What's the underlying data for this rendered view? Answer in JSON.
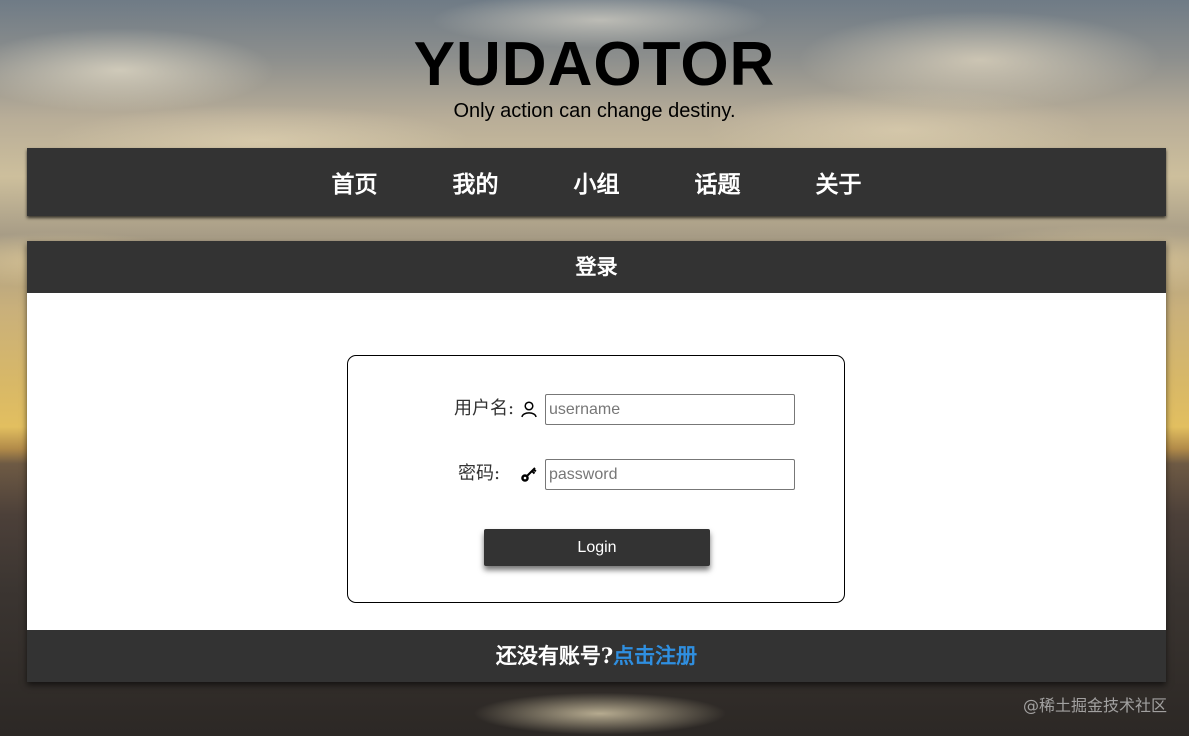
{
  "site": {
    "title": "YUDAOTOR",
    "tagline": "Only action can change destiny."
  },
  "nav": {
    "items": [
      "首页",
      "我的",
      "小组",
      "话题",
      "关于"
    ]
  },
  "login": {
    "header": "登录",
    "username_label": "用户名:",
    "username_placeholder": "username",
    "username_icon": "user-icon",
    "password_label": "密码:",
    "password_placeholder": "password",
    "password_icon": "key-icon",
    "button_label": "Login"
  },
  "footer": {
    "prompt": "还没有账号?",
    "register_link": "点击注册",
    "register_color": "#2f8fe0"
  },
  "watermark": "@稀土掘金技术社区",
  "colors": {
    "bar_background": "#333333",
    "panel_background": "#ffffff"
  }
}
